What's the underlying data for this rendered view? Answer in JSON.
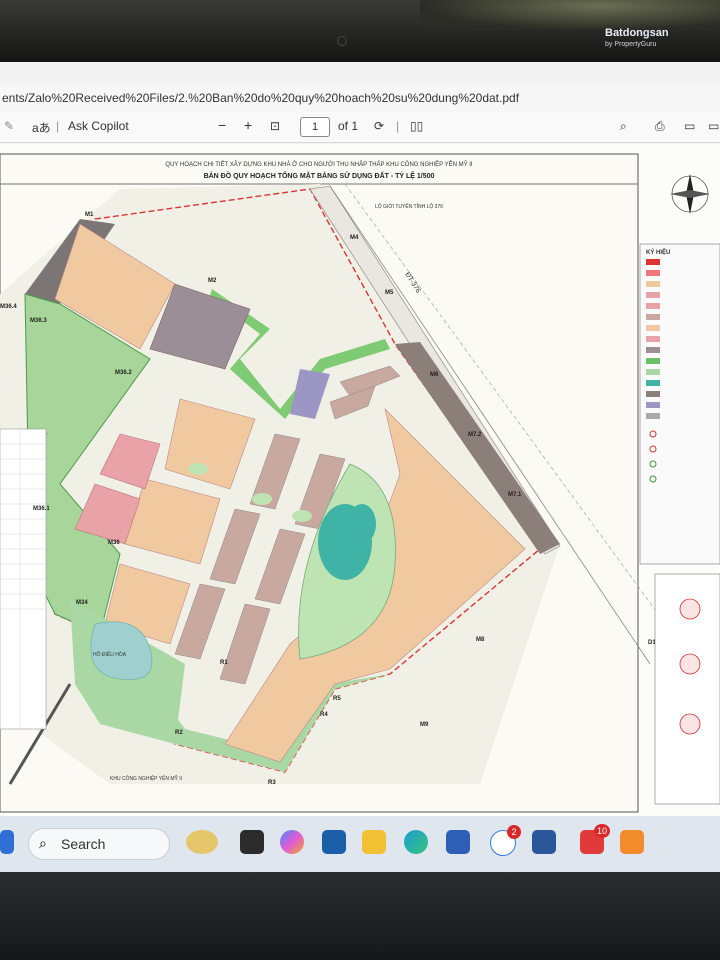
{
  "watermark": {
    "brand": "Batdongsan",
    "sub": "by PropertyGuru"
  },
  "browser": {
    "url": "ents/Zalo%20Received%20Files/2.%20Ban%20do%20quy%20hoach%20su%20dung%20dat.pdf",
    "aa_label": "aあ",
    "copilot_label": "Ask Copilot",
    "zoom_out": "−",
    "zoom_in": "+",
    "page_current": "1",
    "page_total": "of 1"
  },
  "map": {
    "header_line1": "QUY HOẠCH CHI TIẾT XÂY DỰNG KHU NHÀ Ở CHO NGƯỜI THU NHẬP THẤP KHU CÔNG NGHIỆP YÊN MỸ II",
    "header_line2": "BẢN ĐỒ QUY HOẠCH TỔNG MẶT BẰNG SỬ DỤNG ĐẤT - TỶ LỆ 1/500",
    "road_label": "LỘ GIỚI TUYẾN TỈNH LỘ 376",
    "road_name": "ĐT-376",
    "lake_label": "HỒ ĐIỀU HÒA",
    "bottom_label": "KHU CÔNG NGHIỆP YÊN MỸ II",
    "legend_title": "KÝ HIỆU",
    "markers": [
      "M1",
      "M2",
      "M4",
      "M5",
      "M6",
      "M7.2",
      "M7.1",
      "M8",
      "M9",
      "M34",
      "M36",
      "M36.1",
      "M36.2",
      "M36.3",
      "M36.4",
      "R1",
      "R2",
      "R3",
      "R4",
      "R5",
      "D1"
    ]
  },
  "taskbar": {
    "search_label": "Search",
    "zalo_badge": "2",
    "plus_badge": "10",
    "apps": [
      "widgets",
      "task-view",
      "copilot",
      "klarna",
      "file-explorer",
      "edge",
      "microsoft-store",
      "zalo",
      "word",
      "health",
      "anydo"
    ]
  },
  "colors": {
    "residential": "#f0c9a0",
    "pink": "#e8a2a8",
    "green": "#6bc06a",
    "water": "#3fb4a6",
    "mixed": "#9c8e96",
    "outline": "#d33"
  }
}
